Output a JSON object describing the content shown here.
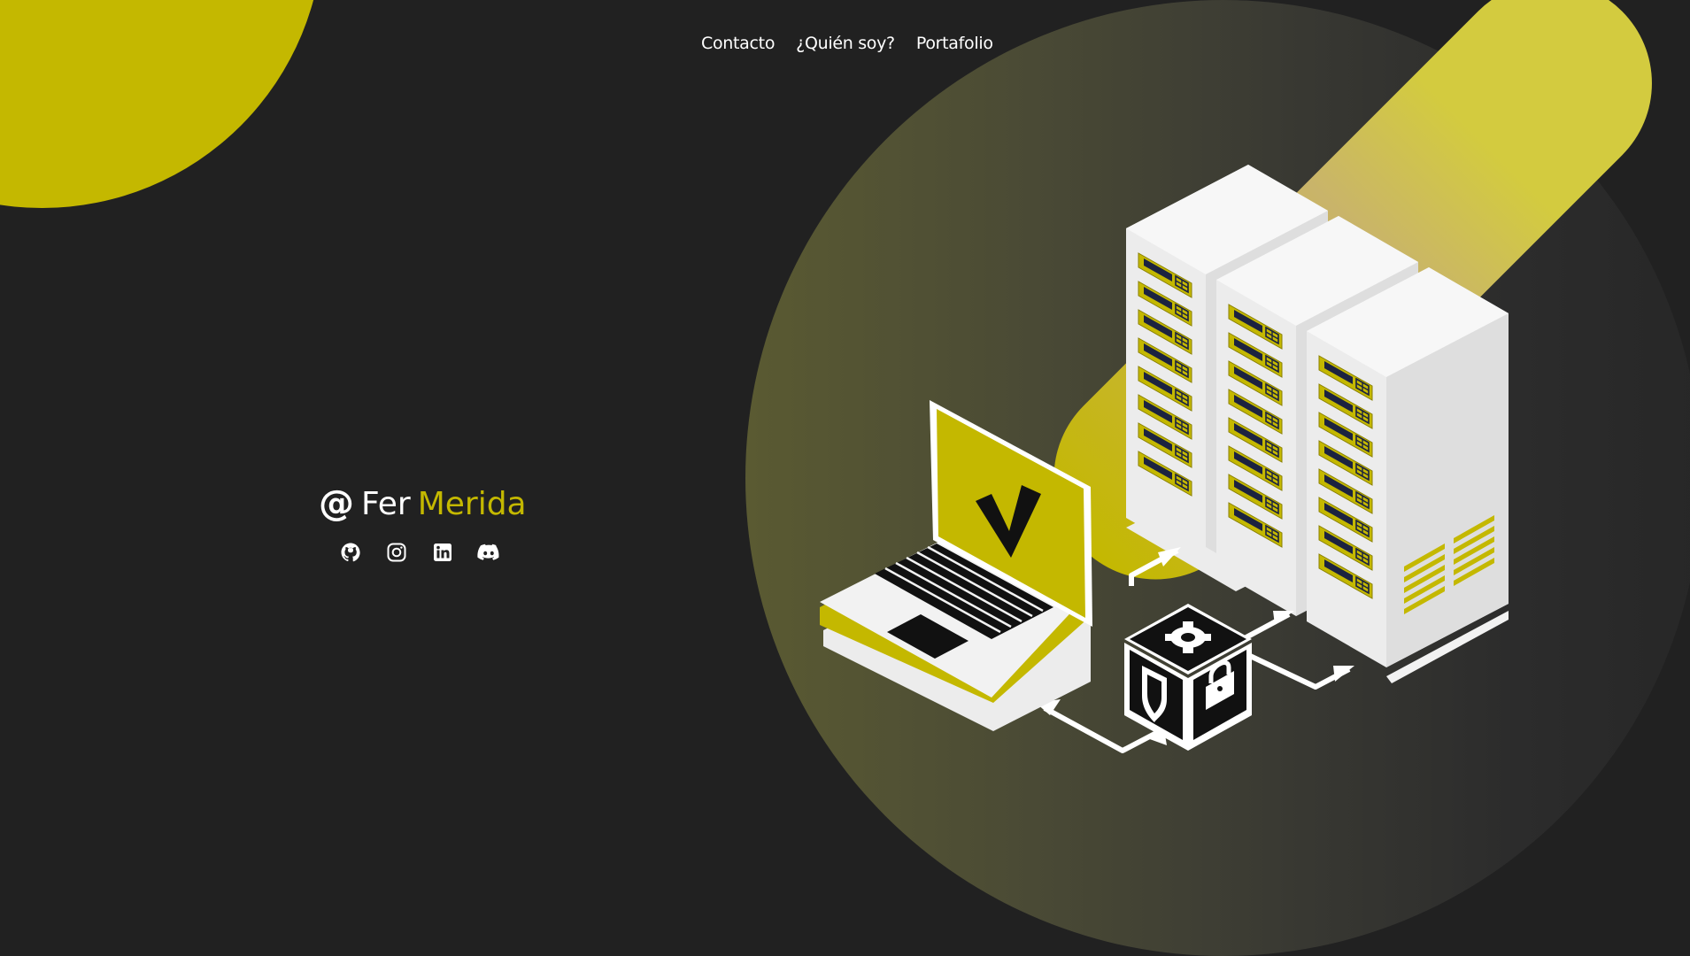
{
  "nav": {
    "items": [
      {
        "label": "Contacto"
      },
      {
        "label": "¿Quién soy?"
      },
      {
        "label": "Portafolio"
      }
    ]
  },
  "brand": {
    "at_symbol": "@",
    "first_name": "Fer",
    "last_name": "Merida"
  },
  "socials": [
    {
      "icon": "github-icon"
    },
    {
      "icon": "instagram-icon"
    },
    {
      "icon": "linkedin-icon"
    },
    {
      "icon": "discord-icon"
    }
  ],
  "colors": {
    "background": "#212121",
    "accent": "#c4b800",
    "text": "#ffffff"
  }
}
